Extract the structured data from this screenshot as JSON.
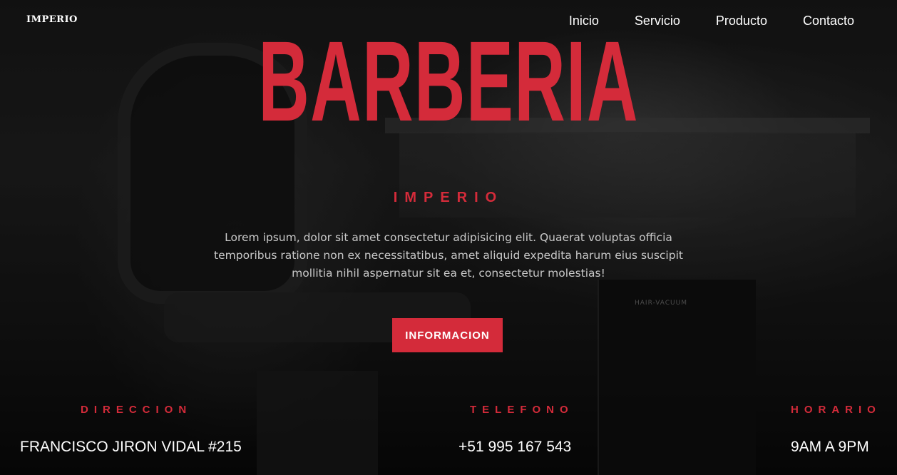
{
  "header": {
    "logo_text": "IMPERIO",
    "nav": [
      "Inicio",
      "Servicio",
      "Producto",
      "Contacto"
    ]
  },
  "background": {
    "label": "HAIR-VACUUM"
  },
  "hero": {
    "title": "BARBERIA",
    "brand": "IMPERIO",
    "description": "Lorem ipsum, dolor sit amet consectetur adipisicing elit. Quaerat voluptas officia temporibus ratione non ex necessitatibus, amet aliquid expedita harum eius suscipit mollitia nihil aspernatur sit ea et, consectetur molestias!",
    "button": "INFORMACION"
  },
  "info": {
    "address_label": "DIRECCION",
    "address_value": "FRANCISCO JIRON VIDAL #215",
    "phone_label": "TELEFONO",
    "phone_value": "+51 995 167 543",
    "hours_label": "HORARIO",
    "hours_value": "9AM A 9PM"
  },
  "colors": {
    "accent": "#d42b3a",
    "text": "#ffffff",
    "muted_text": "#c9c9c9"
  }
}
